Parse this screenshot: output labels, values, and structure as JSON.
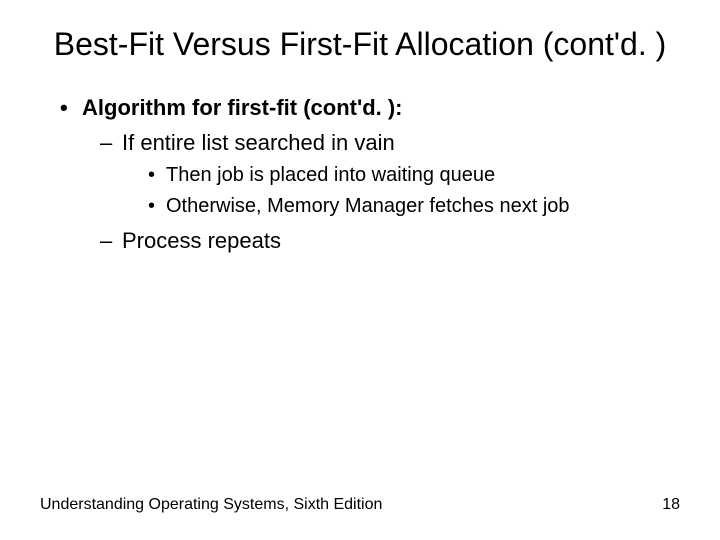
{
  "title": "Best-Fit Versus First-Fit Allocation (cont'd. )",
  "bullets": {
    "l1_0": "Algorithm for first-fit (cont'd. ):",
    "l2_0": "If entire list searched in vain",
    "l3_0": "Then job is placed into waiting queue",
    "l3_1": "Otherwise, Memory Manager fetches next job",
    "l2_1": "Process repeats"
  },
  "footer": {
    "source": "Understanding Operating Systems, Sixth Edition",
    "page": "18"
  }
}
